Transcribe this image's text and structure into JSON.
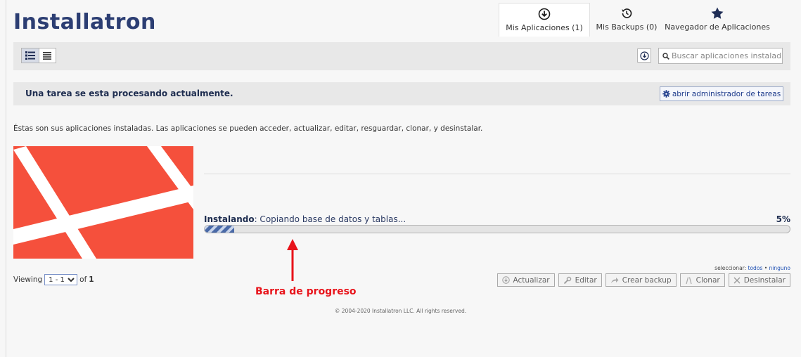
{
  "app": {
    "logo_text": "Installatron",
    "brand_color": "#2c3e73"
  },
  "tabs": [
    {
      "label": "Mis Aplicaciones (1)",
      "icon": "download-circle-icon",
      "active": true
    },
    {
      "label": "Mis Backups (0)",
      "icon": "history-icon",
      "active": false
    },
    {
      "label": "Navegador de Aplicaciones",
      "icon": "star-icon",
      "active": false
    }
  ],
  "toolbar": {
    "view_modes": [
      "detailed-list-icon",
      "compact-list-icon"
    ],
    "search_placeholder": "Buscar aplicaciones instaladas"
  },
  "task": {
    "message": "Una tarea se esta procesando actualmente.",
    "button_label": "abrir administrador de tareas"
  },
  "description": "Éstas son sus aplicaciones instaladas. Las aplicaciones se pueden acceder, actualizar, editar, resguardar, clonar, y desinstalar.",
  "app_card": {
    "status_bold": "Instalando",
    "status_text": ": Copiando base de datos y tablas...",
    "percent_text": "5%",
    "progress": 0.05
  },
  "annotation": {
    "label": "Barra de progreso",
    "color": "#e8141b"
  },
  "pager": {
    "prefix": "Viewing",
    "range": "1 - 1",
    "of_text": "of",
    "total": "1"
  },
  "selection": {
    "prefix": "seleccionar:",
    "all": "todos",
    "separator": "•",
    "none": "ninguno"
  },
  "actions": [
    {
      "label": "Actualizar",
      "icon": "update-icon"
    },
    {
      "label": "Editar",
      "icon": "wrench-icon"
    },
    {
      "label": "Crear backup",
      "icon": "share-arrow-icon"
    },
    {
      "label": "Clonar",
      "icon": "clone-icon"
    },
    {
      "label": "Desinstalar",
      "icon": "x-icon"
    }
  ],
  "footer": "© 2004-2020 Installatron LLC. All rights reserved."
}
